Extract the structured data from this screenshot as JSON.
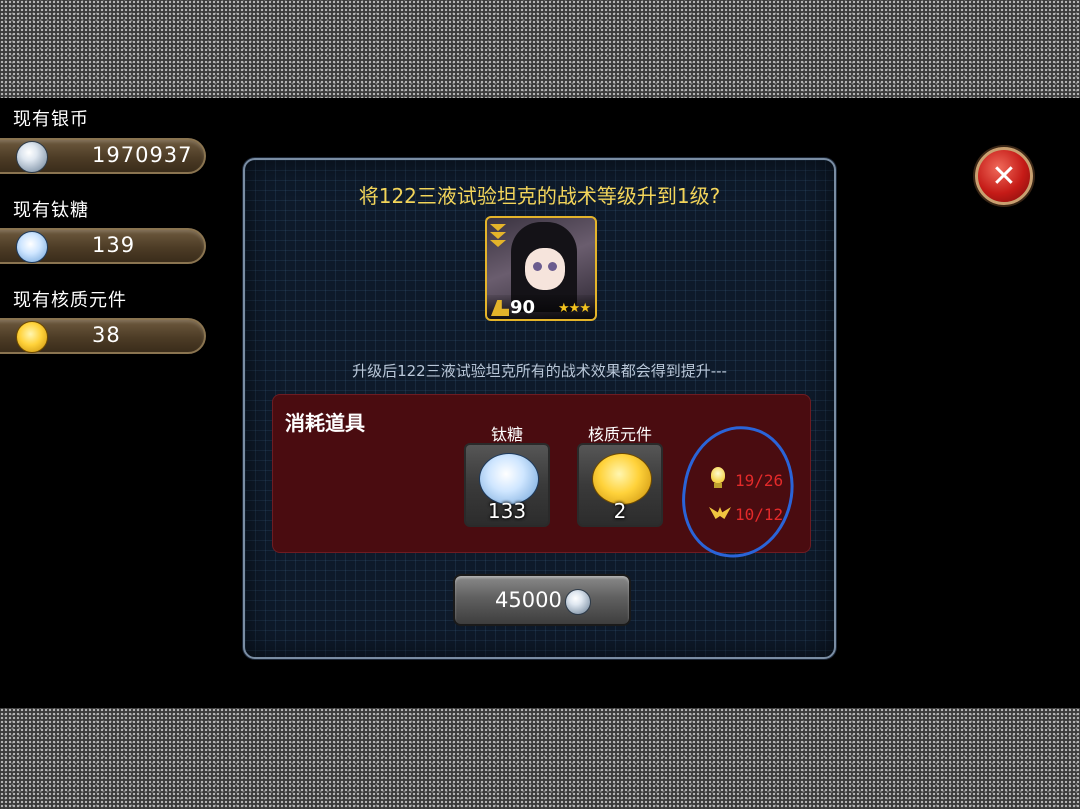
{
  "resources": [
    {
      "label": "现有银币",
      "value": "1970937",
      "icon": "silver-coin-icon"
    },
    {
      "label": "现有钛糖",
      "value": "139",
      "icon": "titanium-candy-icon"
    },
    {
      "label": "现有核质元件",
      "value": "38",
      "icon": "core-component-icon"
    }
  ],
  "dialog": {
    "title": "将122三液试验坦克的战术等级升到1级?",
    "character": {
      "level": "90",
      "stars": "★★★"
    },
    "subtitle": "升级后122三液试验坦克所有的战术效果都会得到提升---",
    "cost": {
      "title": "消耗道具",
      "items": [
        {
          "name": "钛糖",
          "count": "133",
          "icon": "titanium-candy-icon"
        },
        {
          "name": "核质元件",
          "count": "2",
          "icon": "core-component-icon"
        }
      ],
      "stats": [
        {
          "value": "19/26",
          "icon": "lightbulb-icon"
        },
        {
          "value": "10/12",
          "icon": "wings-emblem-icon"
        }
      ]
    },
    "button": {
      "label": "45000",
      "icon": "silver-coin-icon"
    }
  },
  "colors": {
    "title": "#f3d55a",
    "stat": "#e32a2a",
    "cost_bg": "#4a0c10",
    "close": "#c51b17"
  }
}
